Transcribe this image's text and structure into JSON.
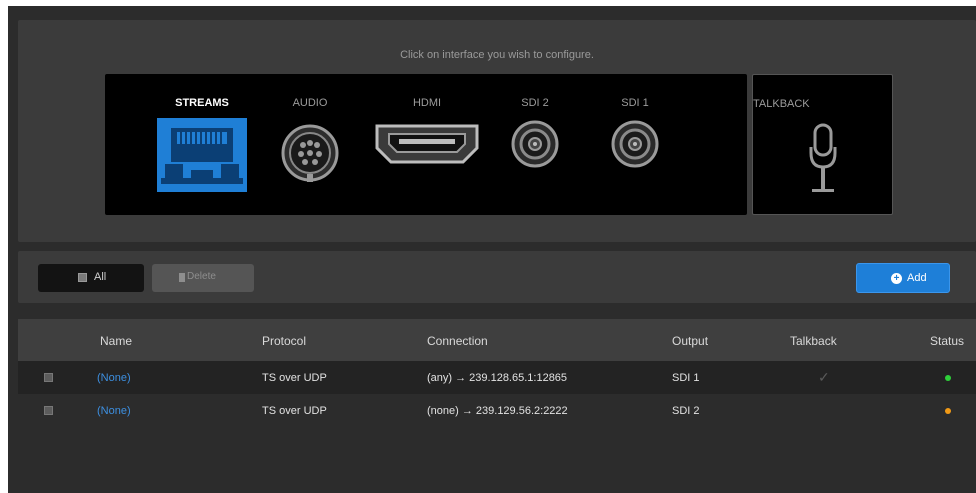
{
  "page": {
    "hint": "Click on interface you wish to configure."
  },
  "interfaces": [
    {
      "label": "STREAMS",
      "icon": "ethernet-port-icon",
      "active": true
    },
    {
      "label": "AUDIO",
      "icon": "audio-connector-icon",
      "active": false
    },
    {
      "label": "HDMI",
      "icon": "hdmi-port-icon",
      "active": false
    },
    {
      "label": "SDI 2",
      "icon": "sdi-connector-icon",
      "active": false
    },
    {
      "label": "SDI 1",
      "icon": "sdi-connector-icon",
      "active": false
    }
  ],
  "talkback": {
    "label": "TALKBACK",
    "icon": "microphone-icon"
  },
  "toolbar": {
    "all_label": "All",
    "delete_label": "Delete",
    "add_label": "Add"
  },
  "table": {
    "headers": [
      "Name",
      "Protocol",
      "Connection",
      "Output",
      "Talkback",
      "Status"
    ],
    "rows": [
      {
        "name": "(None)",
        "protocol": "TS over UDP",
        "connection": "(any) → 239.128.65.1:12865",
        "output": "SDI 1",
        "talkback": true,
        "status_color": "#2ed03a"
      },
      {
        "name": "(None)",
        "protocol": "TS over UDP",
        "connection": "(none) → 239.129.56.2:2222",
        "output": "SDI 2",
        "talkback": false,
        "status_color": "#f19a16"
      }
    ]
  },
  "colors": {
    "accent": "#1e7fd8",
    "active_interface": "#1f7fd6"
  }
}
